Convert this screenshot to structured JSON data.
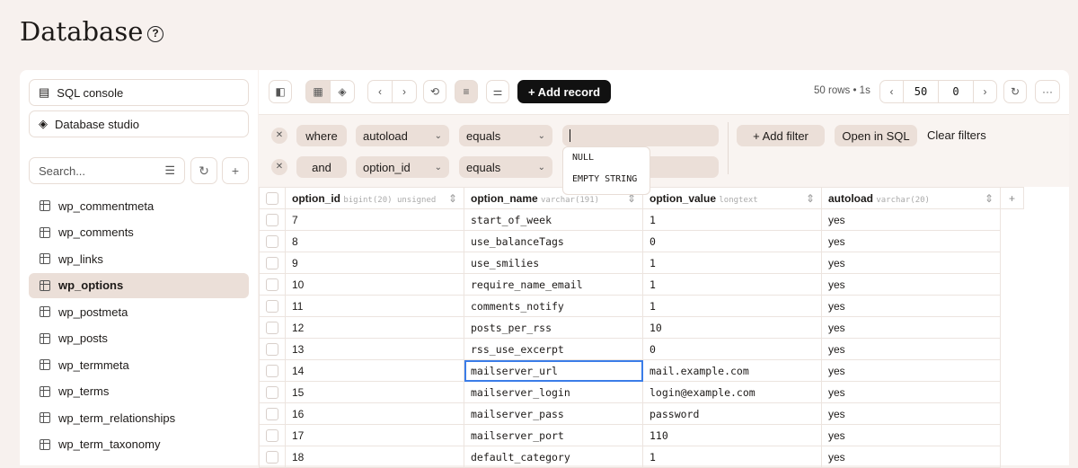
{
  "page": {
    "title": "Database",
    "help_icon": "?"
  },
  "sidebar": {
    "sql_console": "SQL console",
    "database_studio": "Database studio",
    "search_placeholder": "Search...",
    "tables": [
      "wp_commentmeta",
      "wp_comments",
      "wp_links",
      "wp_options",
      "wp_postmeta",
      "wp_posts",
      "wp_termmeta",
      "wp_terms",
      "wp_term_relationships",
      "wp_term_taxonomy"
    ],
    "active_table": "wp_options"
  },
  "toolbar": {
    "add_record": "+ Add record",
    "rows_info": "50 rows • 1s",
    "limit": "50",
    "offset": "0",
    "more": "···"
  },
  "filters": {
    "rows": [
      {
        "conj": "where",
        "column": "autoload",
        "op": "equals",
        "value": ""
      },
      {
        "conj": "and",
        "column": "option_id",
        "op": "equals",
        "value": ""
      }
    ],
    "dropdown": [
      "NULL",
      "EMPTY STRING"
    ],
    "add_filter": "+  Add filter",
    "open_sql": "Open in SQL",
    "clear": "Clear filters"
  },
  "table": {
    "columns": [
      {
        "name": "option_id",
        "type": "bigint(20) unsigned"
      },
      {
        "name": "option_name",
        "type": "varchar(191)"
      },
      {
        "name": "option_value",
        "type": "longtext"
      },
      {
        "name": "autoload",
        "type": "varchar(20)"
      }
    ],
    "rows": [
      [
        "7",
        "start_of_week",
        "1",
        "yes"
      ],
      [
        "8",
        "use_balanceTags",
        "0",
        "yes"
      ],
      [
        "9",
        "use_smilies",
        "1",
        "yes"
      ],
      [
        "10",
        "require_name_email",
        "1",
        "yes"
      ],
      [
        "11",
        "comments_notify",
        "1",
        "yes"
      ],
      [
        "12",
        "posts_per_rss",
        "10",
        "yes"
      ],
      [
        "13",
        "rss_use_excerpt",
        "0",
        "yes"
      ],
      [
        "14",
        "mailserver_url",
        "mail.example.com",
        "yes"
      ],
      [
        "15",
        "mailserver_login",
        "login@example.com",
        "yes"
      ],
      [
        "16",
        "mailserver_pass",
        "password",
        "yes"
      ],
      [
        "17",
        "mailserver_port",
        "110",
        "yes"
      ],
      [
        "18",
        "default_category",
        "1",
        "yes"
      ]
    ]
  }
}
